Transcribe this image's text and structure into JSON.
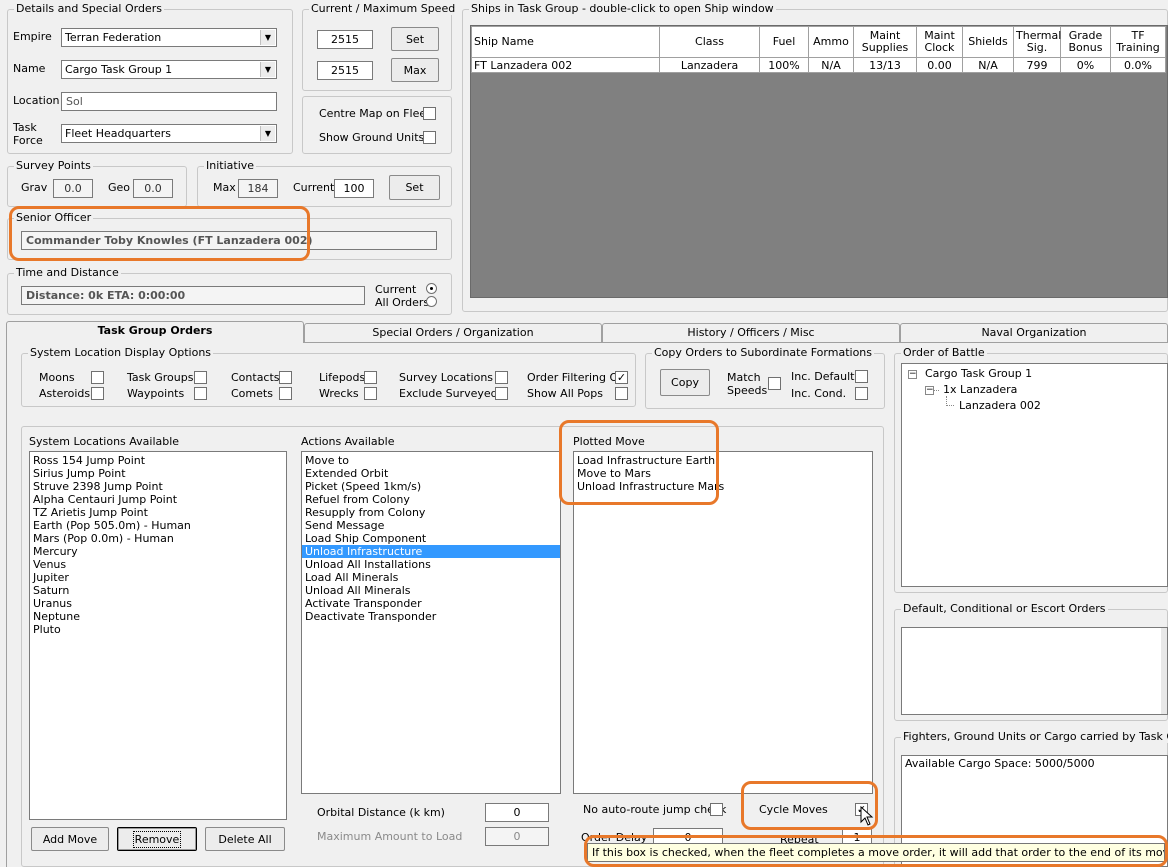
{
  "details": {
    "title": "Details and Special Orders",
    "empire_label": "Empire",
    "empire_value": "Terran Federation",
    "name_label": "Name",
    "name_value": "Cargo Task Group 1",
    "location_label": "Location",
    "location_value": "Sol",
    "task_force_label_1": "Task",
    "task_force_label_2": "Force",
    "task_force_value": "Fleet Headquarters"
  },
  "speed": {
    "title": "Current / Maximum Speed",
    "current": "2515",
    "maximum": "2515",
    "set_label": "Set",
    "max_label": "Max"
  },
  "map_opts": {
    "centre_label": "Centre Map on Fleet",
    "show_ground_label": "Show Ground Units"
  },
  "survey": {
    "title": "Survey Points",
    "grav_label": "Grav",
    "grav_value": "0.0",
    "geo_label": "Geo",
    "geo_value": "0.0"
  },
  "initiative": {
    "title": "Initiative",
    "max_label": "Max",
    "max_value": "184",
    "current_label": "Current",
    "current_value": "100",
    "set_label": "Set"
  },
  "senior_officer": {
    "title": "Senior Officer",
    "value": "Commander Toby Knowles (FT Lanzadera 002)"
  },
  "time_distance": {
    "title": "Time and Distance",
    "value": "Distance: 0k  ETA: 0:00:00",
    "current_label": "Current",
    "all_orders_label": "All Orders"
  },
  "ships": {
    "title": "Ships in Task Group - double-click to open Ship window",
    "headers": [
      "Ship Name",
      "Class",
      "Fuel",
      "Ammo",
      "Maint Supplies",
      "Maint Clock",
      "Shields",
      "Thermal Sig.",
      "Grade Bonus",
      "TF Training"
    ],
    "rows": [
      [
        "FT Lanzadera 002",
        "Lanzadera",
        "100%",
        "N/A",
        "13/13",
        "0.00",
        "N/A",
        "799",
        "0%",
        "0.0%"
      ]
    ]
  },
  "tabs": [
    "Task Group Orders",
    "Special Orders / Organization",
    "History / Officers / Misc",
    "Naval Organization"
  ],
  "display_options": {
    "title": "System Location Display Options",
    "items": [
      {
        "label": "Moons",
        "checked": ""
      },
      {
        "label": "Asteroids",
        "checked": ""
      },
      {
        "label": "Task Groups",
        "checked": ""
      },
      {
        "label": "Waypoints",
        "checked": ""
      },
      {
        "label": "Contacts",
        "checked": ""
      },
      {
        "label": "Comets",
        "checked": ""
      },
      {
        "label": "Lifepods",
        "checked": ""
      },
      {
        "label": "Wrecks",
        "checked": ""
      },
      {
        "label": "Survey Locations",
        "checked": ""
      },
      {
        "label": "Exclude Surveyed",
        "checked": ""
      },
      {
        "label": "Order Filtering On",
        "checked": "✓"
      },
      {
        "label": "Show All Pops",
        "checked": ""
      }
    ]
  },
  "copy_orders": {
    "title": "Copy Orders to Subordinate Formations",
    "copy_label": "Copy",
    "match_label_1": "Match",
    "match_label_2": "Speeds",
    "inc_default_label": "Inc. Default",
    "inc_cond_label": "Inc. Cond."
  },
  "order_of_battle": {
    "title": "Order of Battle",
    "items": [
      "Cargo Task Group 1",
      "1x Lanzadera",
      "Lanzadera 002"
    ]
  },
  "system_locations": {
    "title": "System Locations Available",
    "items": [
      "Ross 154 Jump Point",
      "Sirius Jump Point",
      "Struve 2398 Jump Point",
      "Alpha Centauri Jump Point",
      "TZ Arietis Jump Point",
      "Earth  (Pop 505.0m) - Human",
      "Mars  (Pop 0.0m) - Human",
      "Mercury",
      "Venus",
      "Jupiter",
      "Saturn",
      "Uranus",
      "Neptune",
      "Pluto"
    ]
  },
  "actions": {
    "title": "Actions Available",
    "items": [
      "Move to",
      "Extended Orbit",
      "Picket (Speed 1km/s)",
      "Refuel from Colony",
      "Resupply from Colony",
      "Send Message",
      "Load Ship Component",
      "Unload Infrastructure",
      "Unload All Installations",
      "Load All Minerals",
      "Unload All Minerals",
      "Activate Transponder",
      "Deactivate Transponder"
    ],
    "selected_index": 7
  },
  "plotted": {
    "title": "Plotted Move",
    "items": [
      "Load Infrastructure Earth",
      "Move to Mars",
      "Unload Infrastructure Mars"
    ]
  },
  "default_orders": {
    "title": "Default, Conditional or Escort Orders"
  },
  "cargo": {
    "title": "Fighters, Ground Units or Cargo carried by Task Group",
    "value": "Available Cargo Space: 5000/5000"
  },
  "bottom": {
    "add_move": "Add Move",
    "remove": "Remove",
    "delete_all": "Delete All",
    "orbital_label": "Orbital Distance (k km)",
    "orbital_value": "0",
    "max_amount_label": "Maximum Amount to Load",
    "max_amount_value": "0",
    "no_auto_label": "No auto-route jump check",
    "order_delay_label": "Order Delay",
    "order_delay_value": "0",
    "repeat_label": "Repeat",
    "repeat_value": "1",
    "cycle_label": "Cycle Moves",
    "cycle_checked": "✓"
  },
  "tooltip": "If this box is checked, when the fleet completes a move order, it will add that order to the end of its move list",
  "colors": {
    "highlight": "#e8782a",
    "selection": "#3399ff",
    "ship_area_bg": "#808080"
  }
}
